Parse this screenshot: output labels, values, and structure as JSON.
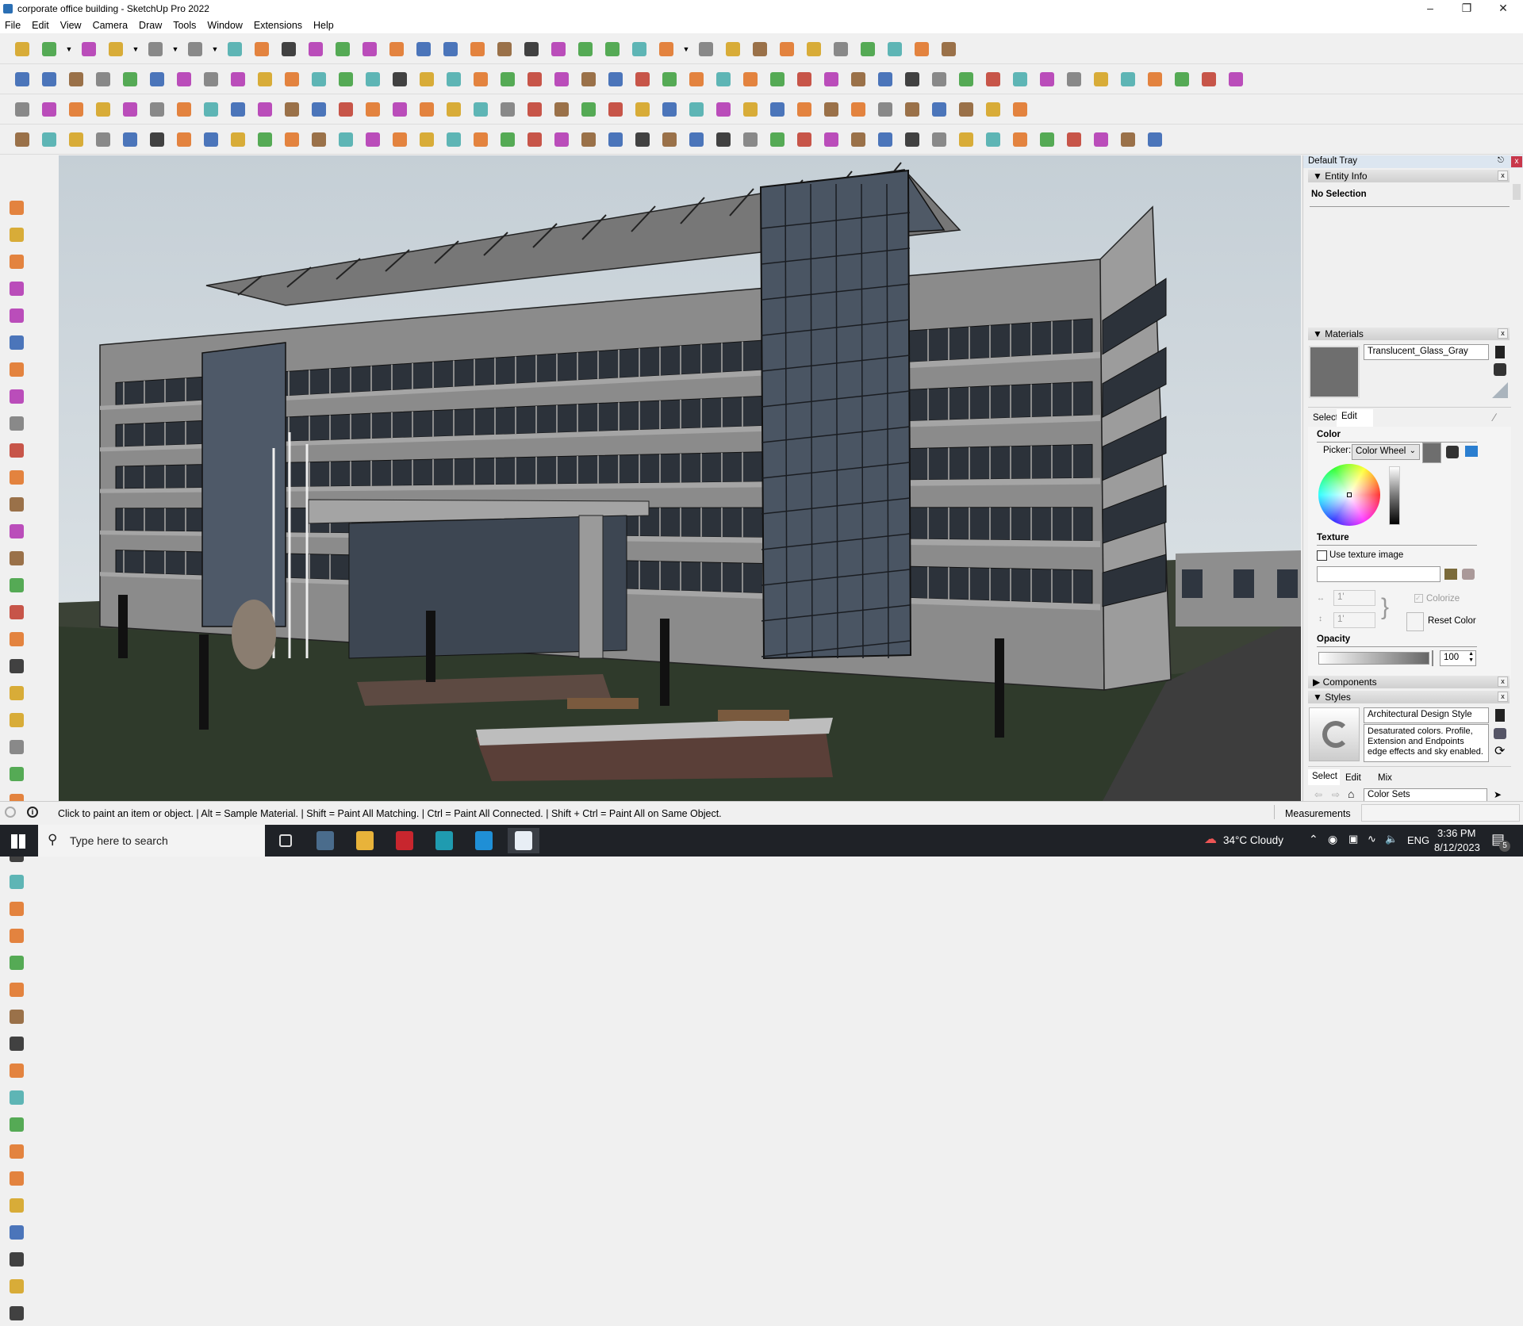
{
  "window": {
    "title": "corporate office building - SketchUp Pro 2022"
  },
  "menu": [
    "File",
    "Edit",
    "View",
    "Camera",
    "Draw",
    "Tools",
    "Window",
    "Extensions",
    "Help"
  ],
  "toolbars": {
    "row1": [
      "zoom-extents",
      "select",
      "dropdown",
      "eraser",
      "line",
      "dropdown",
      "arc",
      "dropdown",
      "rectangle",
      "dropdown",
      "push-pull",
      "follow-me",
      "move",
      "rotate",
      "scale",
      "tape-measure",
      "text",
      "paint-bucket",
      "orbit",
      "pan",
      "zoom",
      "zoom-window",
      "section-plane",
      "section-fill",
      "display-section",
      "xray",
      "user",
      "dropdown",
      "warehouse",
      "extension-warehouse",
      "send-to-layout",
      "flip-blue",
      "flip-red",
      "axes",
      "position-camera",
      "undo",
      "redo",
      "trimble-connect"
    ],
    "row2": [
      "solid-union",
      "solid-subtract",
      "solid-trim",
      "push-pull-plus",
      "joint-push-pull",
      "normal-push-pull",
      "round-push-pull",
      "vector-push-pull",
      "push-pull-n",
      "extrude-x",
      "follow-push-pull",
      "curve-fillet",
      "edge-blue",
      "edge-red",
      "edge-red-2",
      "terrain",
      "sandbox",
      "house-1",
      "house-2",
      "house-3",
      "house-4",
      "house-5",
      "house-6",
      "dimension",
      "label",
      "pencil-tool",
      "shape-1",
      "shape-2",
      "shape-3",
      "shape-4",
      "shape-5",
      "shape-6",
      "shape-7",
      "shape-8",
      "shape-9",
      "shape-10",
      "shape-11",
      "paint-line",
      "eraser-pink",
      "solid-tool-1",
      "solid-tool-2",
      "solid-tool-3",
      "solid-tool-4",
      "solid-tool-5",
      "solid-tool-6",
      "solid-tool-7"
    ],
    "row3": [
      "layer-blue-hash",
      "layer-blue",
      "layer-yellow",
      "layer-green",
      "layer-red",
      "layer-gray",
      "loop",
      "window-red",
      "frame",
      "flag",
      "wall",
      "pipe",
      "corner",
      "polyline-points",
      "cross-red",
      "cross-green",
      "cross-blue",
      "water-drop",
      "hash-tool",
      "warning",
      "ring",
      "ring-2",
      "ring-3",
      "move-arrows",
      "box",
      "curl",
      "component-green",
      "component-red",
      "component-red-2",
      "component-box",
      "component-tool",
      "grid-tool",
      "grid-orange",
      "grid-orange-2",
      "grid-orange-3",
      "close-red",
      "curve-dots",
      "arrange"
    ],
    "row4": [
      "page",
      "curve-points",
      "scissors",
      "trim",
      "circle-dashed",
      "shape-outline",
      "bend",
      "cube-outline",
      "sphere",
      "cube-point",
      "fillet",
      "chamfer",
      "angle",
      "offset",
      "frame-3d",
      "surface",
      "stair-1",
      "stair-2",
      "stair-3",
      "stair-4",
      "shape-a",
      "shape-b",
      "shape-c",
      "shape-d",
      "line-a",
      "line-b",
      "line-c",
      "line-d",
      "block-a",
      "block-b",
      "block-c",
      "block-d",
      "block-e",
      "block-f",
      "block-g",
      "block-h",
      "block-i",
      "block-j",
      "block-k",
      "block-l",
      "block-m",
      "block-n",
      "block-o"
    ]
  },
  "left_toolbar": [
    "select",
    "orbit",
    "paint-bucket",
    "eraser",
    "component",
    "pencil",
    "line",
    "freehand",
    "rectangle",
    "rotated-rectangle",
    "circle",
    "polygon",
    "arc",
    "pie",
    "arc-3",
    "arc-2",
    "move",
    "push-pull",
    "rotate",
    "follow-me",
    "scale",
    "offset",
    "tape-measure",
    "dimension",
    "protractor",
    "text",
    "axes",
    "3d-text",
    "orbit-2",
    "pan",
    "zoom",
    "zoom-window",
    "zoom-extents",
    "previous",
    "position-camera",
    "look-around",
    "walk",
    "section-plane",
    "section-plane-2",
    "section-display",
    "section-fill",
    "section-cut"
  ],
  "tray": {
    "title": "Default Tray",
    "entity_info": {
      "label": "Entity Info",
      "selection": "No Selection"
    },
    "materials": {
      "label": "Materials",
      "name": "Translucent_Glass_Gray",
      "swatch_color": "#6e6e6e",
      "tabs": [
        "Select",
        "Edit"
      ],
      "color_label": "Color",
      "picker_label": "Picker:",
      "picker_value": "Color Wheel",
      "texture_label": "Texture",
      "use_texture": "Use texture image",
      "use_texture_checked": false,
      "tex_width": "1'",
      "tex_height": "1'",
      "colorize": "Colorize",
      "reset_color": "Reset Color",
      "opacity_label": "Opacity",
      "opacity": "100"
    },
    "components": {
      "label": "Components"
    },
    "styles": {
      "label": "Styles",
      "name": "Architectural Design Style",
      "description": "Desaturated colors. Profile, Extension and Endpoints edge effects and sky enabled.",
      "tabs": [
        "Select",
        "Edit",
        "Mix"
      ],
      "collection": "Color Sets"
    }
  },
  "status": {
    "hint": "Click to paint an item or object. | Alt = Sample Material. | Shift = Paint All Matching. | Ctrl = Paint All Connected. | Shift + Ctrl = Paint All on Same Object.",
    "measurements_label": "Measurements",
    "measurements_value": ""
  },
  "taskbar": {
    "search_placeholder": "Type here to search",
    "apps": [
      "task-view",
      "calculator",
      "file-explorer",
      "autocad",
      "3ds-max",
      "edge",
      "sketchup"
    ],
    "weather": "34°C  Cloudy",
    "language": "ENG",
    "time": "3:36 PM",
    "date": "8/12/2023",
    "notifications": "5"
  }
}
